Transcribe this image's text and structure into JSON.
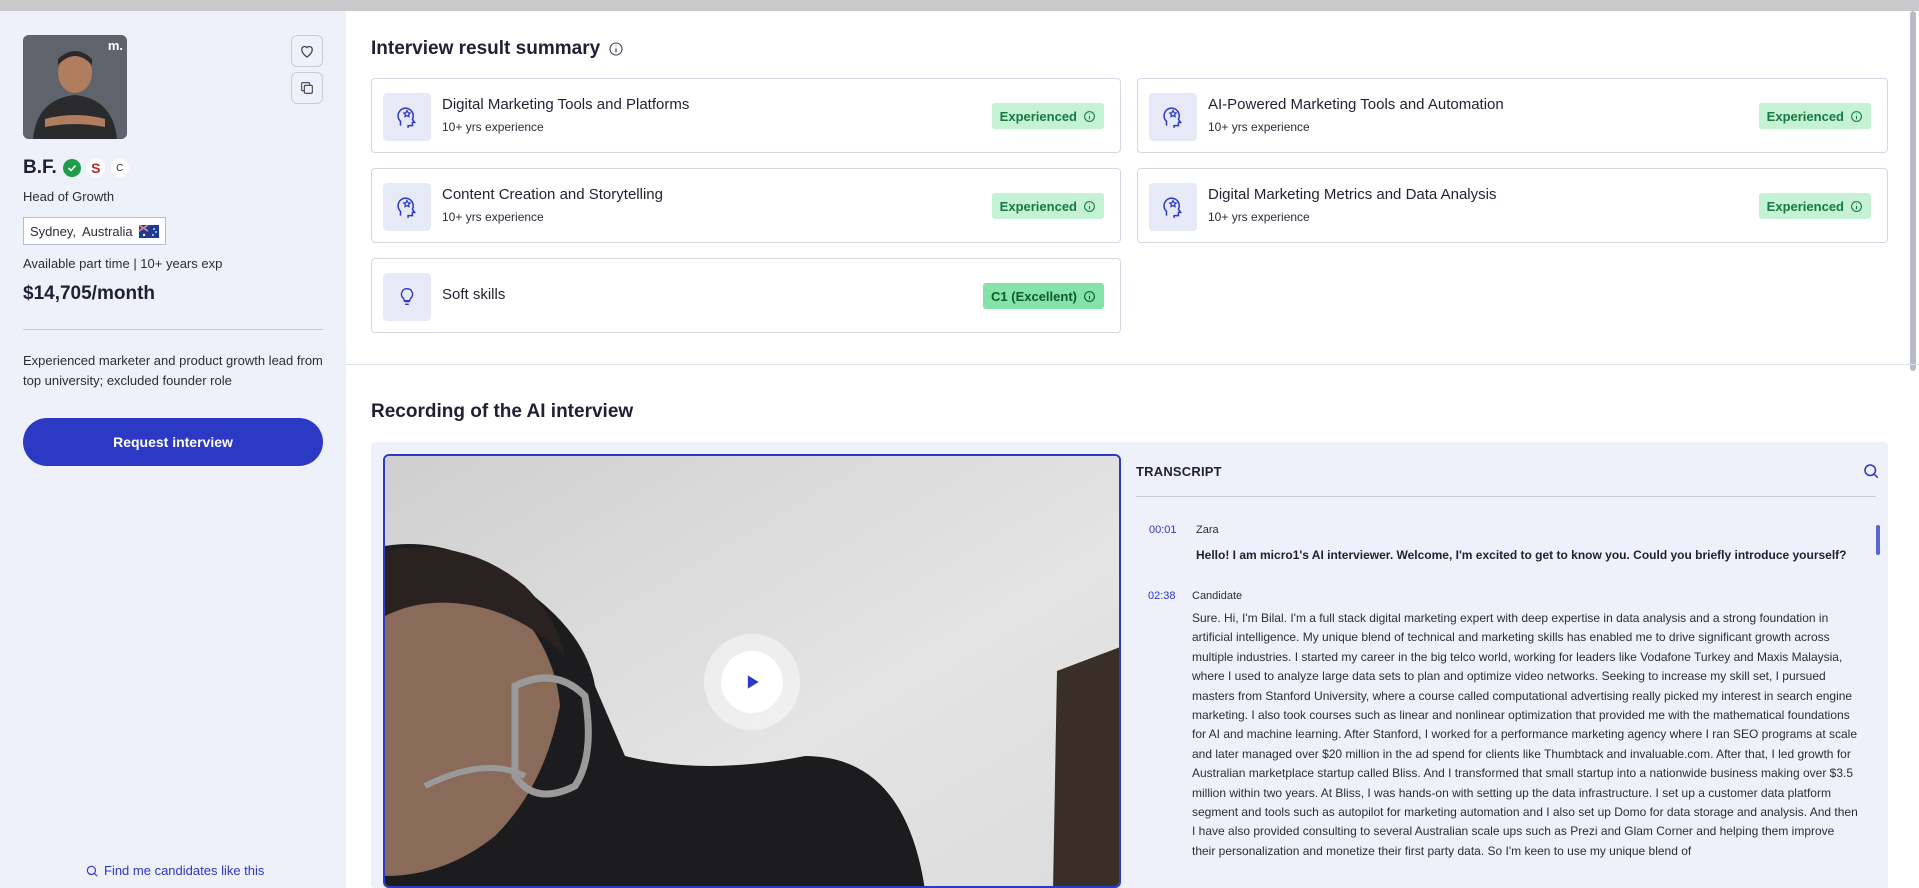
{
  "candidate": {
    "name": "B.F.",
    "avatar_badge": "m.",
    "small_badge": "C",
    "uni_logo_letter": "S",
    "title": "Head of Growth",
    "location": {
      "city": "Sydney,",
      "country": "Australia"
    },
    "availability": "Available part time | 10+ years exp",
    "rate": "$14,705/month",
    "summary": "Experienced marketer and product growth lead from top university; excluded founder role"
  },
  "actions": {
    "request_interview": "Request interview",
    "find_similar": "Find me candidates like this"
  },
  "interview_summary": {
    "title": "Interview result summary",
    "skills": [
      {
        "name": "Digital Marketing Tools and Platforms",
        "experience": "10+ yrs experience",
        "level": "Experienced",
        "icon": "brain-star-icon"
      },
      {
        "name": "AI-Powered Marketing Tools and Automation",
        "experience": "10+ yrs experience",
        "level": "Experienced",
        "icon": "brain-star-icon"
      },
      {
        "name": "Content Creation and Storytelling",
        "experience": "10+ yrs experience",
        "level": "Experienced",
        "icon": "brain-star-icon"
      },
      {
        "name": "Digital Marketing Metrics and Data Analysis",
        "experience": "10+ yrs experience",
        "level": "Experienced",
        "icon": "brain-star-icon"
      },
      {
        "name": "Soft skills",
        "experience": "",
        "level": "C1 (Excellent)",
        "icon": "lightbulb-icon"
      }
    ]
  },
  "recording": {
    "title": "Recording of the AI interview",
    "transcript_header": "TRANSCRIPT",
    "entries": [
      {
        "time": "00:01",
        "speaker": "Zara",
        "text": "Hello! I am micro1's AI interviewer. Welcome, I'm excited to get to know you. Could you briefly introduce yourself?"
      },
      {
        "time": "02:38",
        "speaker": "Candidate",
        "text": "Sure. Hi, I'm Bilal. I'm a full stack digital marketing expert with deep expertise in data analysis and a strong foundation in artificial intelligence. My unique blend of technical and marketing skills has enabled me to drive significant growth across multiple industries. I started my career in the big telco world, working for leaders like Vodafone Turkey and Maxis Malaysia, where I used to analyze large data sets to plan and optimize video networks. Seeking to increase my skill set, I pursued masters from Stanford University, where a course called computational advertising really picked my interest in search engine marketing. I also took courses such as linear and nonlinear optimization that provided me with the mathematical foundations for AI and machine learning. After Stanford, I worked for a performance marketing agency where I ran SEO programs at scale and later managed over $20 million in the ad spend for clients like Thumbtack and invaluable.com. After that, I led growth for Australian marketplace startup called Bliss. And I transformed that small startup into a nationwide business making over $3.5 million within two years. At Bliss, I was hands-on with setting up the data infrastructure. I set up a customer data platform segment and tools such as autopilot for marketing automation and I also set up Domo for data storage and analysis. And then I have also provided consulting to several Australian scale ups such as Prezi and Glam Corner and helping them improve their personalization and monetize their first party data. So I'm keen to use my unique blend of"
      }
    ]
  },
  "colors": {
    "primary": "#2c39c4",
    "sidebar_bg": "#eef0fa",
    "badge_bg": "#c5f1d4",
    "badge_text": "#177a3f",
    "verified": "#1f9d4b"
  }
}
